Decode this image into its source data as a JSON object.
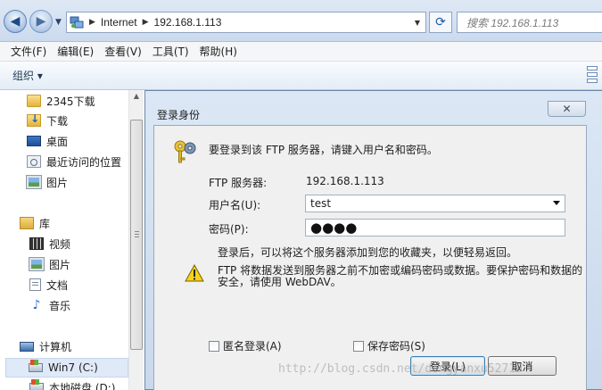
{
  "address": {
    "segments": [
      "Internet",
      "192.168.1.113"
    ],
    "search_placeholder": "搜索 192.168.1.113"
  },
  "menu": [
    "文件(F)",
    "编辑(E)",
    "查看(V)",
    "工具(T)",
    "帮助(H)"
  ],
  "command_bar": {
    "organize": "组织 ▾"
  },
  "nav_tree": {
    "favorites": [
      "2345下载",
      "下载",
      "桌面",
      "最近访问的位置",
      "图片"
    ],
    "library_root": "库",
    "libraries": [
      "视频",
      "图片",
      "文档",
      "音乐"
    ],
    "computer_root": "计算机",
    "drives": [
      "Win7 (C:)",
      "本地磁盘 (D:)"
    ]
  },
  "dialog": {
    "title": "登录身份",
    "close": "✕",
    "prompt": "要登录到该 FTP 服务器，请键入用户名和密码。",
    "server_label": "FTP 服务器:",
    "server_value": "192.168.1.113",
    "username_label": "用户名(U):",
    "username_value": "test",
    "password_label": "密码(P):",
    "password_mask": "●●●●",
    "hint": "登录后，可以将这个服务器添加到您的收藏夹，以便轻易返回。",
    "warning": "FTP 将数据发送到服务器之前不加密或编码密码或数据。要保护密码和数据的安全，请使用 WebDAV。",
    "anonymous_label": "匿名登录(A)",
    "save_password_label": "保存密码(S)",
    "login_button": "登录(L)",
    "cancel_button": "取消"
  },
  "watermark": "http://blog.csdn.net/dongyanxu52719"
}
